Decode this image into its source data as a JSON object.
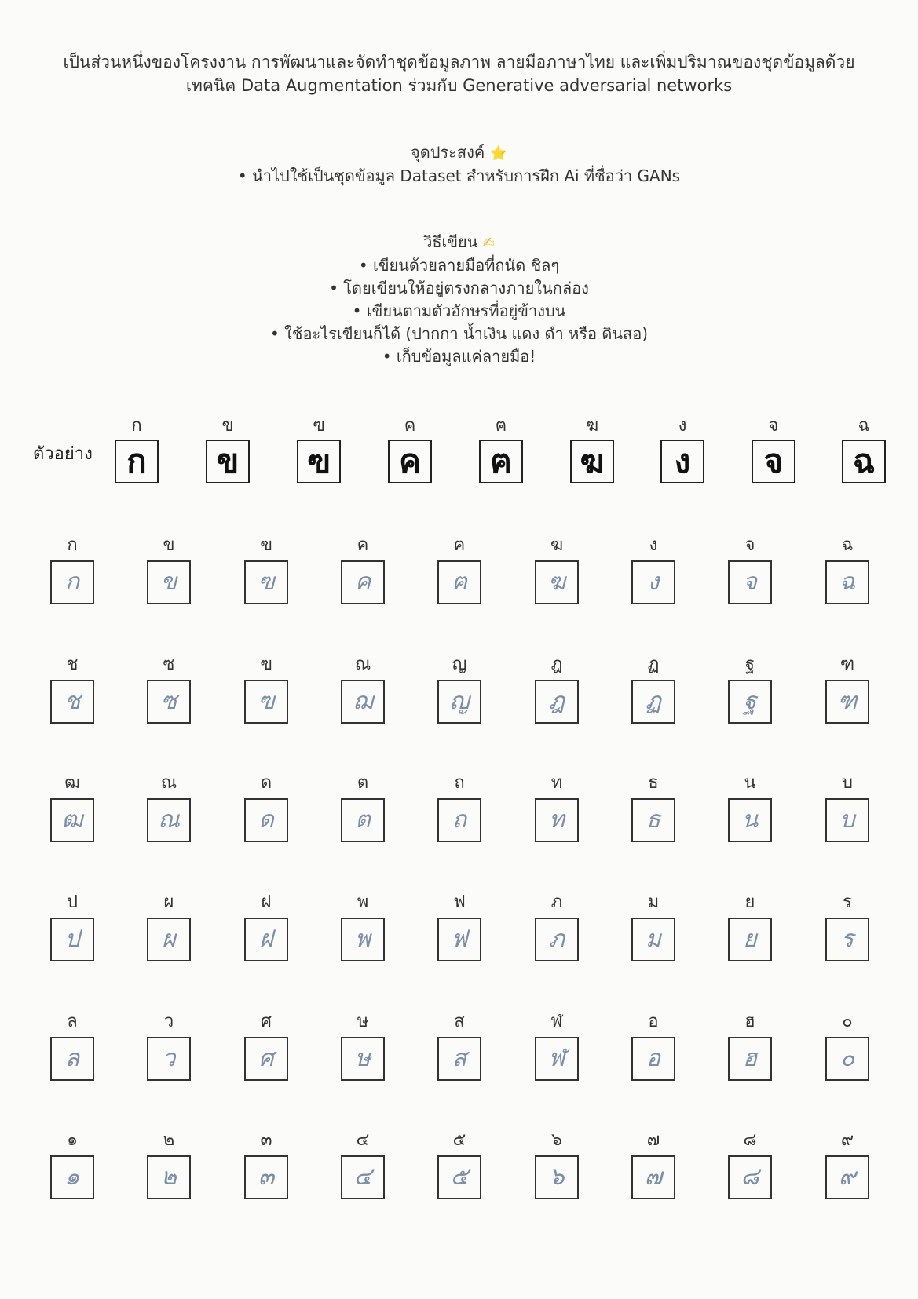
{
  "intro": {
    "line1": "เป็นส่วนหนึ่งของโครงงาน การพัฒนาและจัดทำชุดข้อมูลภาพ ลายมือภาษาไทย และเพิ่มปริมาณของชุดข้อมูลด้วย",
    "line2": "เทคนิค Data Augmentation ร่วมกับ Generative adversarial networks"
  },
  "goal": {
    "title": "จุดประสงค์",
    "emoji": "⭐",
    "bullet": "นำไปใช้เป็นชุดข้อมูล Dataset สำหรับการฝึก Ai ที่ชื่อว่า GANs"
  },
  "howto": {
    "title": "วิธีเขียน",
    "emoji": "✍",
    "bullets": [
      "เขียนด้วยลายมือที่ถนัด ชิลๆ",
      "โดยเขียนให้อยู่ตรงกลางภายในกล่อง",
      "เขียนตามตัวอักษรที่อยู่ข้างบน",
      "ใช้อะไรเขียนก็ได้ (ปากกา น้ำเงิน แดง ดำ หรือ ดินสอ)",
      "เก็บข้อมูลแค่ลายมือ!"
    ]
  },
  "example": {
    "label": "ตัวอย่าง",
    "letters": [
      "ก",
      "ข",
      "ฃ",
      "ค",
      "ฅ",
      "ฆ",
      "ง",
      "จ",
      "ฉ"
    ]
  },
  "rows": [
    [
      "ก",
      "ข",
      "ฃ",
      "ค",
      "ฅ",
      "ฆ",
      "ง",
      "จ",
      "ฉ"
    ],
    [
      "ช",
      "ซ",
      "ฃ",
      "ณ",
      "ญ",
      "ฎ",
      "ฏ",
      "ฐ",
      "ฑ"
    ],
    [
      "ฒ",
      "ณ",
      "ด",
      "ต",
      "ถ",
      "ท",
      "ธ",
      "น",
      "บ"
    ],
    [
      "ป",
      "ผ",
      "ฝ",
      "พ",
      "ฟ",
      "ภ",
      "ม",
      "ย",
      "ร"
    ],
    [
      "ล",
      "ว",
      "ศ",
      "ษ",
      "ส",
      "ฬ",
      "อ",
      "ฮ",
      "๐"
    ],
    [
      "๑",
      "๒",
      "๓",
      "๔",
      "๕",
      "๖",
      "๗",
      "๘",
      "๙"
    ]
  ],
  "handwriting": [
    [
      "ก",
      "ข",
      "ฃ",
      "ค",
      "ฅ",
      "ฆ",
      "ง",
      "จ",
      "ฉ"
    ],
    [
      "ช",
      "ซ",
      "ฃ",
      "ฌ",
      "ญ",
      "ฎ",
      "ฏ",
      "ฐ",
      "ฑ"
    ],
    [
      "ฒ",
      "ณ",
      "ด",
      "ต",
      "ถ",
      "ท",
      "ธ",
      "น",
      "บ"
    ],
    [
      "ป",
      "ผ",
      "ฝ",
      "พ",
      "ฟ",
      "ภ",
      "ม",
      "ย",
      "ร"
    ],
    [
      "ล",
      "ว",
      "ศ",
      "ษ",
      "ส",
      "ฬ",
      "อ",
      "ฮ",
      "๐"
    ],
    [
      "๑",
      "๒",
      "๓",
      "๔",
      "๕",
      "๖",
      "๗",
      "๘",
      "๙"
    ]
  ]
}
